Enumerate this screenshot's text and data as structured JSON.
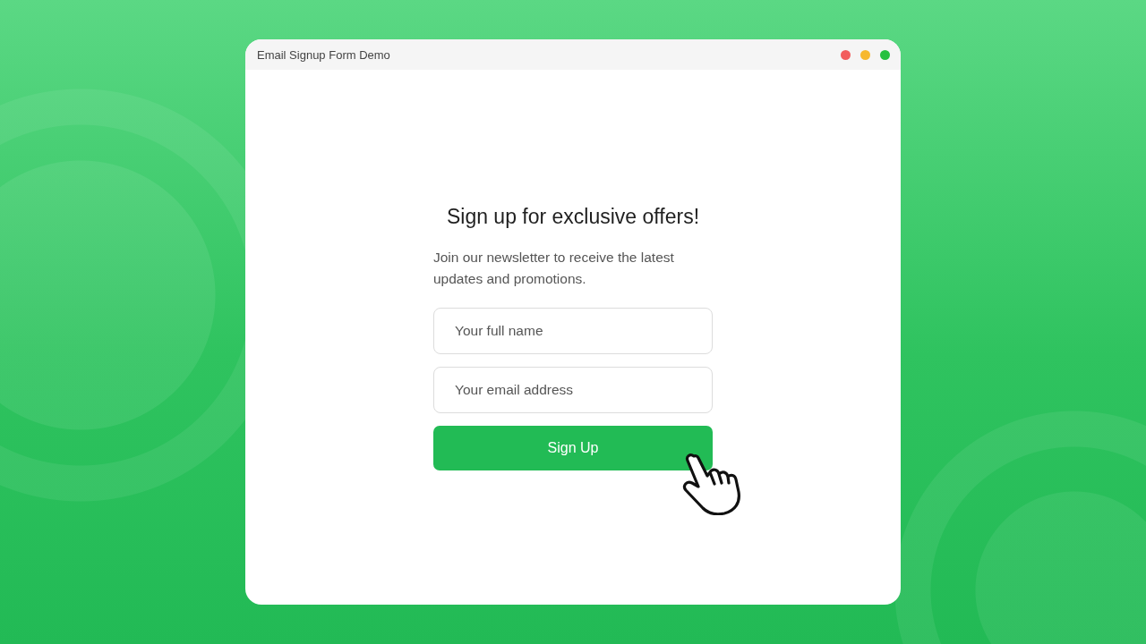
{
  "window": {
    "title": "Email Signup Form Demo",
    "controls": [
      {
        "color": "#f25c5c"
      },
      {
        "color": "#f7b82e"
      },
      {
        "color": "#27c03f"
      }
    ]
  },
  "form": {
    "heading": "Sign up for exclusive offers!",
    "description": "Join our newsletter to receive the latest updates and promotions.",
    "fields": [
      {
        "placeholder": "Your full name"
      },
      {
        "placeholder": "Your email address"
      }
    ],
    "button": "Sign Up"
  }
}
